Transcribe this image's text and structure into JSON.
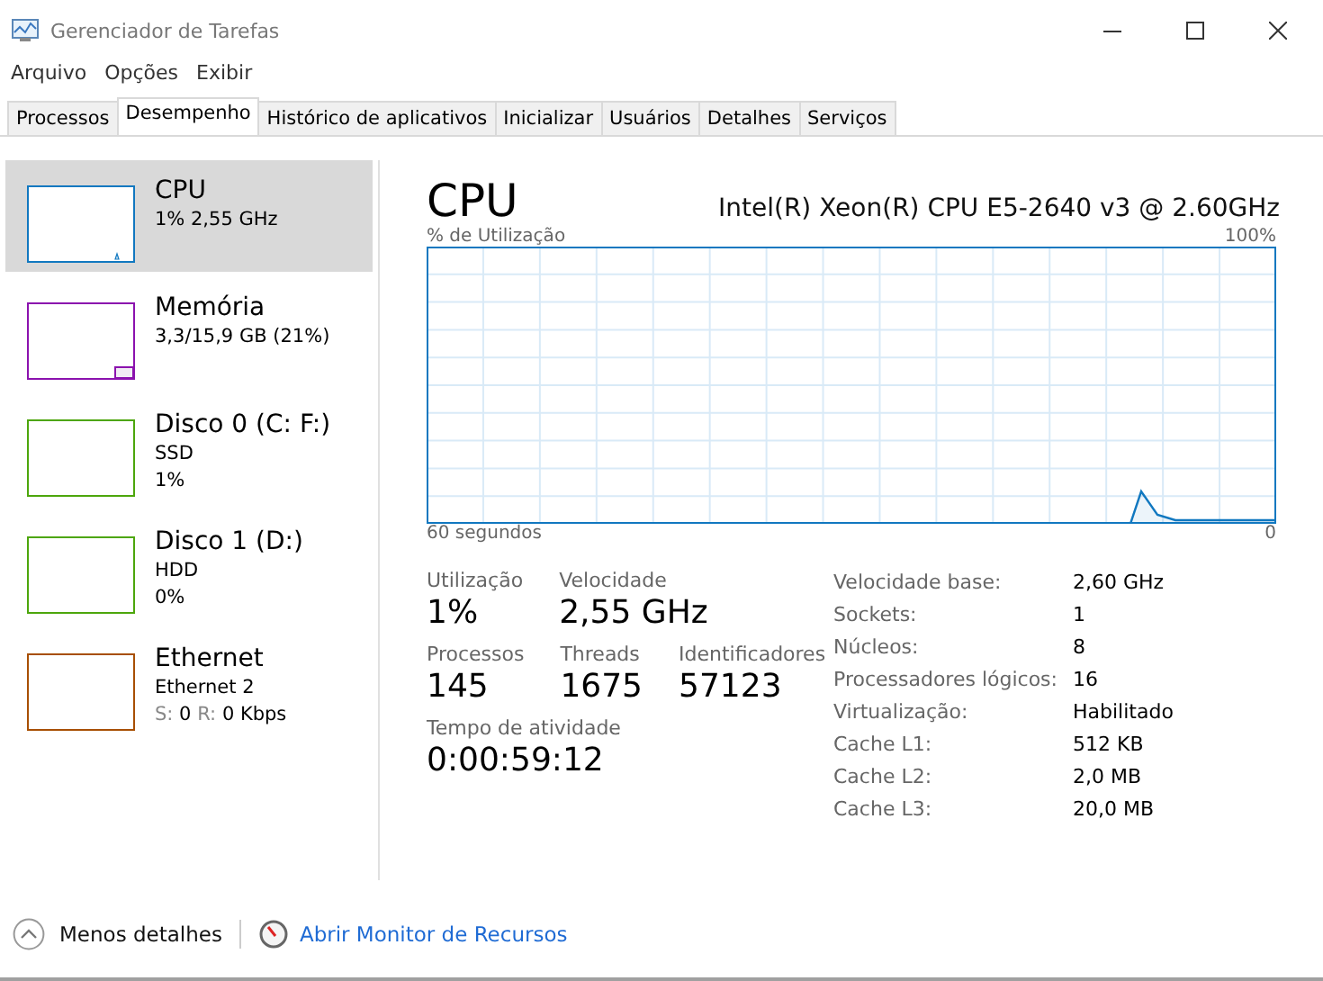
{
  "window": {
    "title": "Gerenciador de Tarefas"
  },
  "menu": [
    "Arquivo",
    "Opções",
    "Exibir"
  ],
  "tabs": [
    {
      "label": "Processos",
      "selected": false
    },
    {
      "label": "Desempenho",
      "selected": true
    },
    {
      "label": "Histórico de aplicativos",
      "selected": false
    },
    {
      "label": "Inicializar",
      "selected": false
    },
    {
      "label": "Usuários",
      "selected": false
    },
    {
      "label": "Detalhes",
      "selected": false
    },
    {
      "label": "Serviços",
      "selected": false
    }
  ],
  "sidebar": {
    "items": [
      {
        "kind": "cpu",
        "name": "CPU",
        "lines": [
          [
            {
              "text": "1% 2,55 GHz",
              "muted": false
            }
          ]
        ],
        "color": "#1178c0",
        "selected": true
      },
      {
        "kind": "memory",
        "name": "Memória",
        "lines": [
          [
            {
              "text": "3,3/15,9 GB (21%)",
              "muted": false
            }
          ]
        ],
        "color": "#8b12ae",
        "selected": false
      },
      {
        "kind": "disk",
        "name": "Disco 0 (C: F:)",
        "lines": [
          [
            {
              "text": "SSD",
              "muted": false
            }
          ],
          [
            {
              "text": "1%",
              "muted": false
            }
          ]
        ],
        "color": "#4da60c",
        "selected": false
      },
      {
        "kind": "disk",
        "name": "Disco 1 (D:)",
        "lines": [
          [
            {
              "text": "HDD",
              "muted": false
            }
          ],
          [
            {
              "text": "0%",
              "muted": false
            }
          ]
        ],
        "color": "#4da60c",
        "selected": false
      },
      {
        "kind": "network",
        "name": "Ethernet",
        "lines": [
          [
            {
              "text": "Ethernet 2",
              "muted": false
            }
          ],
          [
            {
              "text": "S:",
              "muted": true
            },
            {
              "text": "0",
              "muted": false
            },
            {
              "text": "R:",
              "muted": true
            },
            {
              "text": "0 Kbps",
              "muted": false
            }
          ]
        ],
        "color": "#a74f01",
        "selected": false
      }
    ]
  },
  "detail": {
    "title": "CPU",
    "model": "Intel(R) Xeon(R) CPU E5-2640 v3 @ 2.60GHz",
    "graph": {
      "ylabel": "% de Utilização",
      "max_label": "100%",
      "time_label": "60 segundos",
      "min_label": "0"
    },
    "stats": [
      [
        {
          "label": "Utilização",
          "value": "1%"
        },
        {
          "label": "Velocidade",
          "value": "2,55 GHz"
        }
      ],
      [
        {
          "label": "Processos",
          "value": "145"
        },
        {
          "label": "Threads",
          "value": "1675"
        },
        {
          "label": "Identificadores",
          "value": "57123"
        }
      ],
      [
        {
          "label": "Tempo de atividade",
          "value": "0:00:59:12"
        }
      ]
    ],
    "properties": [
      {
        "label": "Velocidade base:",
        "value": "2,60 GHz"
      },
      {
        "label": "Sockets:",
        "value": "1"
      },
      {
        "label": "Núcleos:",
        "value": "8"
      },
      {
        "label": "Processadores lógicos:",
        "value": "16"
      },
      {
        "label": "Virtualização:",
        "value": "Habilitado"
      },
      {
        "label": "Cache L1:",
        "value": "512 KB"
      },
      {
        "label": "Cache L2:",
        "value": "2,0 MB"
      },
      {
        "label": "Cache L3:",
        "value": "20,0 MB"
      }
    ]
  },
  "footer": {
    "less_details": "Menos detalhes",
    "monitor_link": "Abrir Monitor de Recursos"
  }
}
